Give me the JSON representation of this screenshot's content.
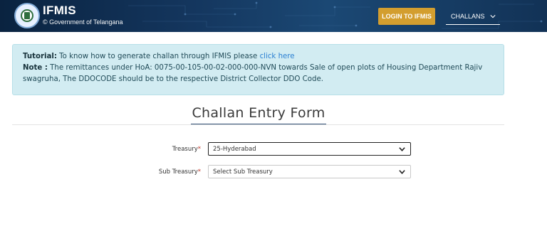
{
  "header": {
    "brand_name": "IFMIS",
    "brand_sub": "© Government of Telangana",
    "login_label": "LOGIN TO IFMIS",
    "menu_label": "CHALLANS"
  },
  "notice": {
    "tutorial_label": "Tutorial:",
    "tutorial_text": " To know how to generate challan through IFMIS please ",
    "tutorial_link": "click here",
    "note_label": "Note :",
    "note_text": " The remittances under HoA: 0075-00-105-00-02-000-000-NVN towards Sale of open plots of Housing Department Rajiv swagruha, The DDOCODE should be to the respective District Collector DDO Code."
  },
  "form": {
    "title": "Challan Entry Form",
    "treasury_label": "Treasury",
    "treasury_value": "25-Hyderabad",
    "subtreasury_label": "Sub Treasury",
    "subtreasury_value": "Select Sub Treasury",
    "required_mark": "*"
  },
  "colors": {
    "header_bg": "#14365e",
    "login_button": "#d39e2f",
    "notice_bg": "#d2ecf2",
    "link": "#2a7fd2",
    "required": "#c0392b"
  }
}
